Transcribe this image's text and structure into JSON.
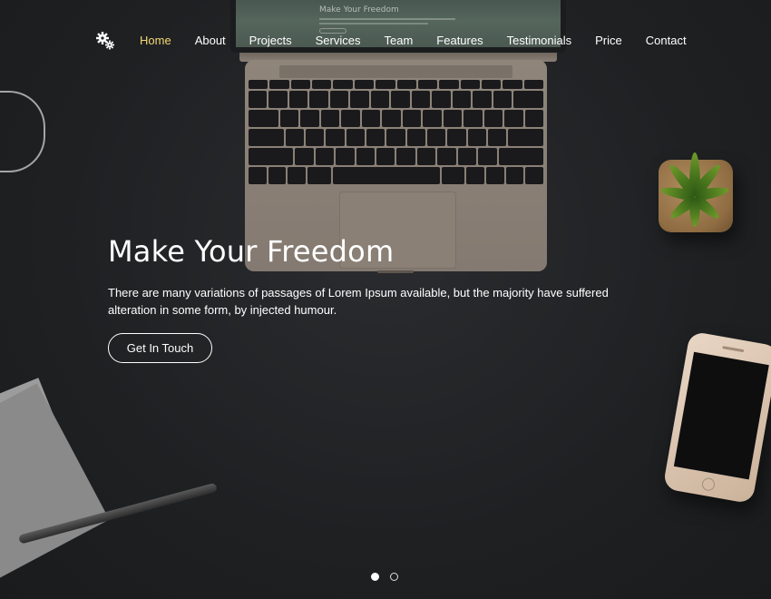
{
  "nav": {
    "logo_icon": "gears-icon",
    "items": [
      {
        "label": "Home",
        "active": true
      },
      {
        "label": "About"
      },
      {
        "label": "Projects"
      },
      {
        "label": "Services"
      },
      {
        "label": "Team"
      },
      {
        "label": "Features"
      },
      {
        "label": "Testimonials"
      },
      {
        "label": "Price"
      },
      {
        "label": "Contact"
      }
    ]
  },
  "laptop_screen": {
    "title": "Make Your Freedom"
  },
  "hero": {
    "title": "Make Your Freedom",
    "description": "There are many variations of passages of Lorem Ipsum available, but the majority have suffered alteration in some form, by injected humour.",
    "cta_label": "Get In Touch"
  },
  "slider": {
    "dots": 2,
    "active_index": 0
  },
  "colors": {
    "active_nav": "#f4d873",
    "background": "#1f2123"
  }
}
